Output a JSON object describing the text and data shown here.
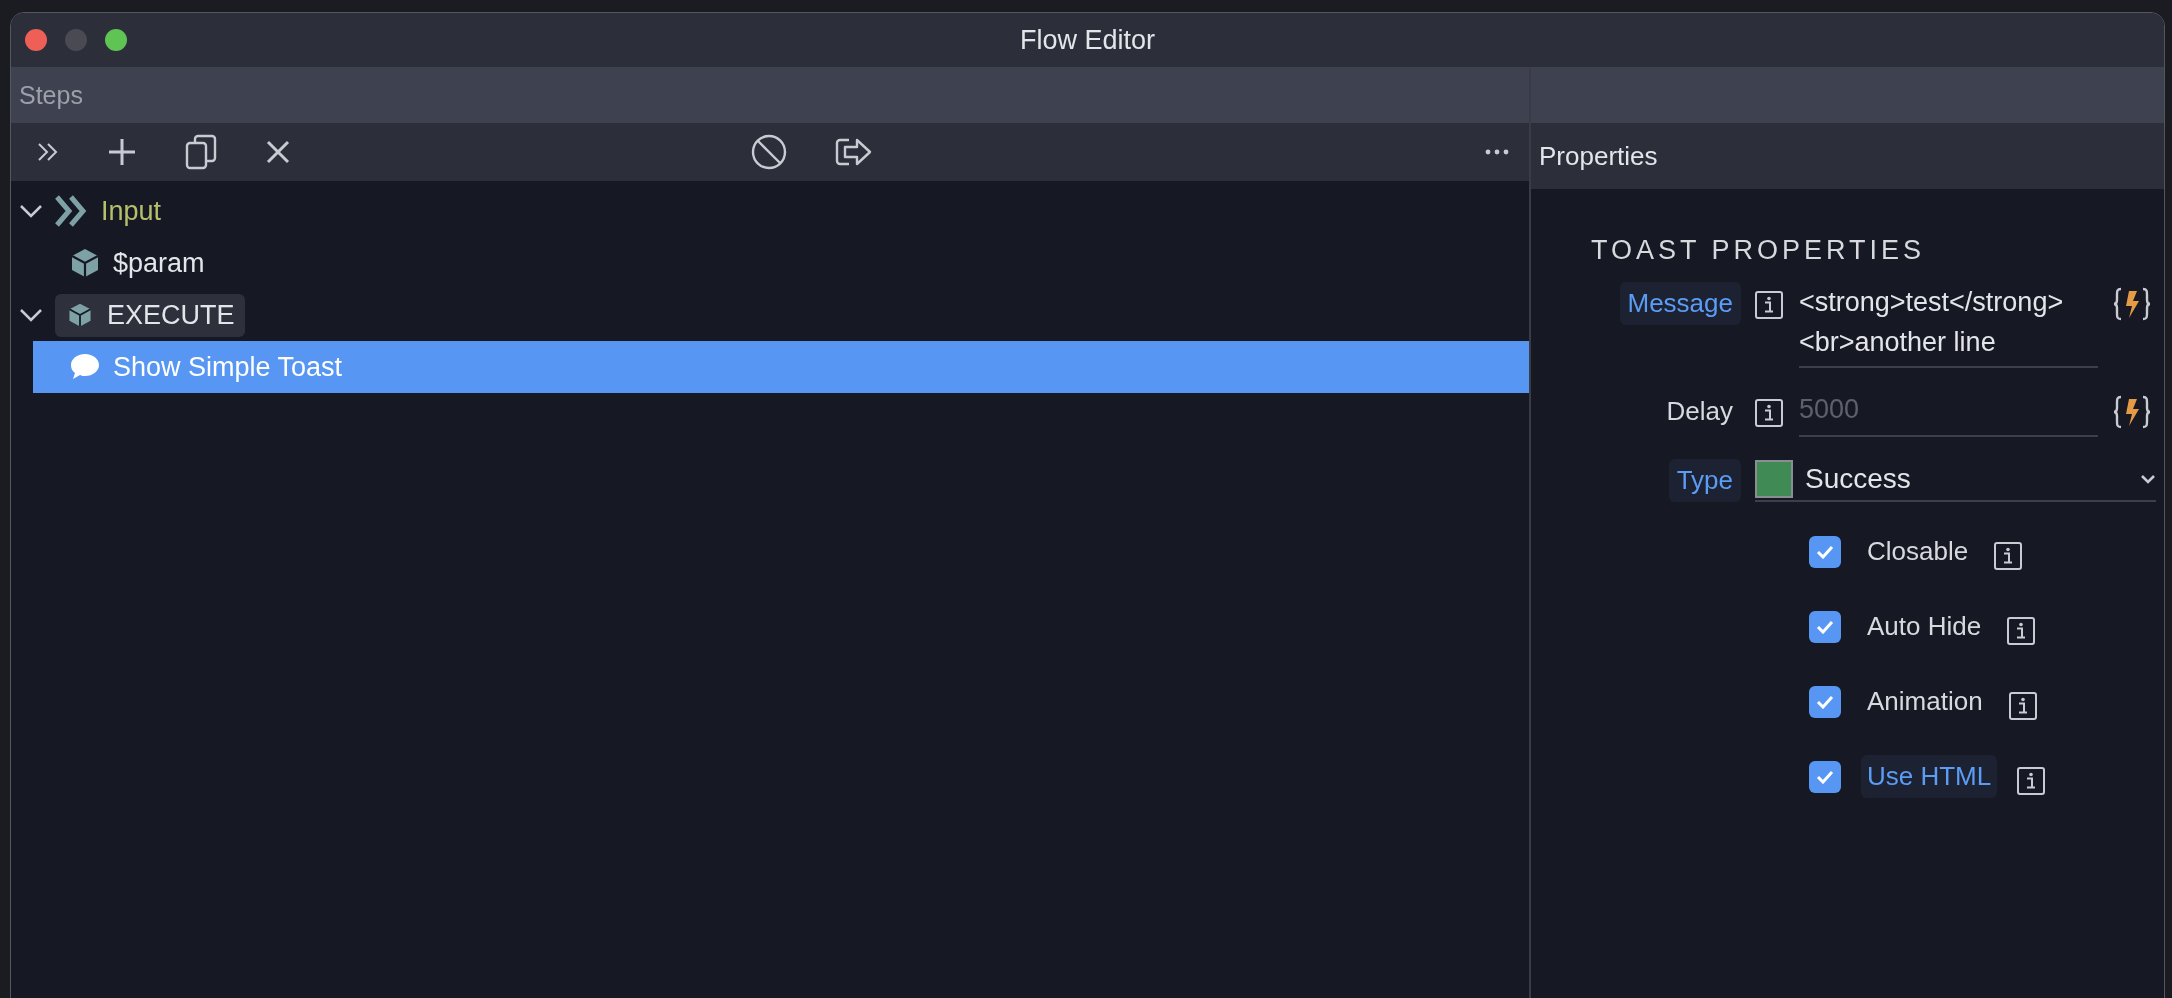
{
  "window": {
    "title": "Flow Editor"
  },
  "steps": {
    "title": "Steps",
    "tree": [
      {
        "kind": "input",
        "label": "Input",
        "expanded": true,
        "selected": false,
        "children": [
          {
            "kind": "param",
            "label": "$param",
            "selected": false
          }
        ]
      },
      {
        "kind": "group",
        "label": "EXECUTE",
        "expanded": true,
        "selected": false,
        "children": [
          {
            "kind": "toast",
            "label": "Show Simple Toast",
            "selected": true
          }
        ]
      }
    ]
  },
  "properties": {
    "title": "Properties",
    "section": "TOAST PROPERTIES",
    "message": {
      "label": "Message",
      "highlighted": true,
      "value": "<strong>test</strong> <br>another line"
    },
    "delay": {
      "label": "Delay",
      "highlighted": false,
      "placeholder": "5000"
    },
    "type": {
      "label": "Type",
      "highlighted": true,
      "value": "Success",
      "color": "#3f8a55"
    },
    "options": [
      {
        "label": "Closable",
        "checked": true,
        "highlighted": false
      },
      {
        "label": "Auto Hide",
        "checked": true,
        "highlighted": false
      },
      {
        "label": "Animation",
        "checked": true,
        "highlighted": false
      },
      {
        "label": "Use HTML",
        "checked": true,
        "highlighted": true
      }
    ]
  }
}
